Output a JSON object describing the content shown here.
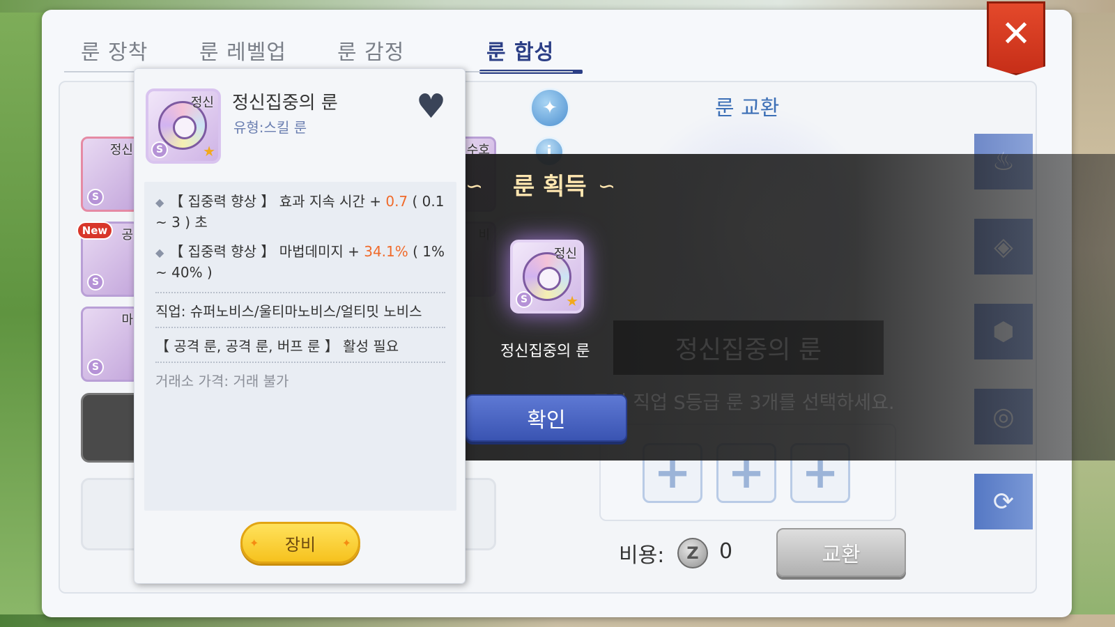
{
  "tabs": [
    {
      "label": "룬 장착",
      "active": false
    },
    {
      "label": "룬 레벨업",
      "active": false
    },
    {
      "label": "룬 감정",
      "active": false
    },
    {
      "label": "룬 합성",
      "active": true
    }
  ],
  "close_icon": "close-icon",
  "tooltip": {
    "rune_mark": "정신",
    "grade_badge": "S",
    "name": "정신집중의 룬",
    "type": "유형:스킬 룬",
    "favorite_icon": "heart-icon",
    "effects": [
      {
        "prefix": "【 집중력 향상 】 효과 지속 시간 + ",
        "value": "0.7",
        "suffix": " ( 0.1 ~ 3 ) 초"
      },
      {
        "prefix": "【 집중력 향상 】 마법데미지 + ",
        "value": "34.1%",
        "suffix": " ( 1% ~ 40% )"
      }
    ],
    "job": "직업: 슈퍼노비스/울티마노비스/얼티밋 노비스",
    "requirement": "【 공격 룬, 공격 룬, 버프 룬 】 활성 필요",
    "trade": "거래소 가격: 거래 불가",
    "equip_button": "장비"
  },
  "left_grid": {
    "new_badge": "New",
    "slot_marks": [
      "정신",
      "공",
      "마"
    ],
    "right_marks": [
      "수호",
      "비"
    ]
  },
  "right_panel": {
    "title": "룬 교환",
    "bg_rune_mark": "정신",
    "bg_rune_name": "정신집중의 룬",
    "instruction": "동일 직업 S등급 룬 3개를 선택하세요.",
    "slots": [
      "+",
      "+",
      "+"
    ],
    "cost_label": "비용:",
    "coin_letter": "Z",
    "cost_value": "0",
    "exchange_button": "교환",
    "side_tabs": [
      "fire-rune-icon",
      "water-rune-icon",
      "earth-rune-icon",
      "wind-rune-icon",
      "exchange-rune-icon"
    ]
  },
  "acquire_overlay": {
    "title": "룬 획득",
    "rune_mark": "정신",
    "grade_badge": "S",
    "rune_name": "정신집중의 룬",
    "confirm_button": "확인"
  },
  "colors": {
    "tab_active": "#2c3f86",
    "highlight": "#f06a2a",
    "close": "#d83a20",
    "confirm": "#3a54b2",
    "equip": "#f6c21e"
  }
}
